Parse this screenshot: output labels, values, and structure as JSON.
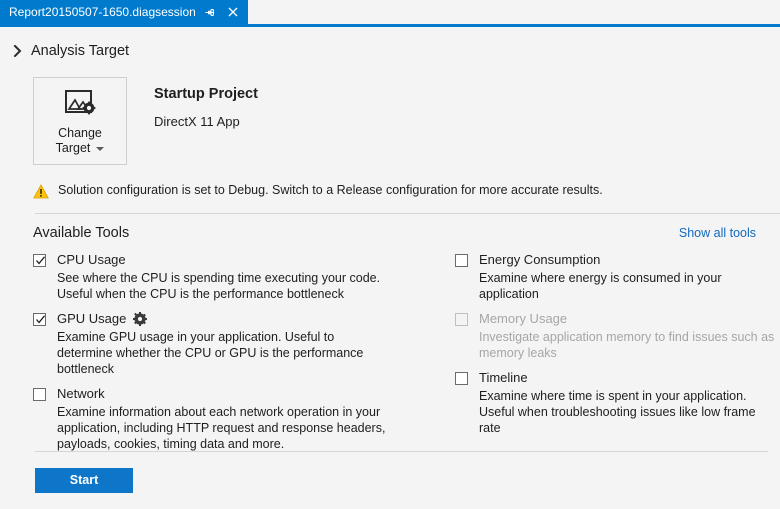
{
  "tab": {
    "title": "Report20150507-1650.diagsession",
    "pin_icon": "pin-icon",
    "close_icon": "close-icon"
  },
  "analysis_target": {
    "expander_icon": "chevron-right-icon",
    "section_title": "Analysis Target",
    "change_target": {
      "icon": "picture-settings-icon",
      "line1": "Change",
      "line2": "Target",
      "caret_icon": "caret-down-icon"
    },
    "project_label": "Startup Project",
    "project_name": "DirectX 11 App"
  },
  "warning": {
    "icon": "warning-triangle-icon",
    "text": "Solution configuration is set to Debug. Switch to a Release configuration for more accurate results."
  },
  "available_tools": {
    "title": "Available Tools",
    "show_all_link": "Show all tools",
    "left_column": [
      {
        "name": "CPU Usage",
        "checked": true,
        "enabled": true,
        "has_settings": false,
        "description": "See where the CPU is spending time executing your code. Useful when the CPU is the performance bottleneck"
      },
      {
        "name": "GPU Usage",
        "checked": true,
        "enabled": true,
        "has_settings": true,
        "settings_icon": "gear-icon",
        "description": "Examine GPU usage in your application. Useful to determine whether the CPU or GPU is the performance bottleneck"
      },
      {
        "name": "Network",
        "checked": false,
        "enabled": true,
        "has_settings": false,
        "description": "Examine information about each network operation in your application, including HTTP request and response headers, payloads, cookies, timing data and more."
      }
    ],
    "right_column": [
      {
        "name": "Energy Consumption",
        "checked": false,
        "enabled": true,
        "has_settings": false,
        "description": "Examine where energy is consumed in your application"
      },
      {
        "name": "Memory Usage",
        "checked": false,
        "enabled": false,
        "has_settings": false,
        "description": "Investigate application memory to find issues such as memory leaks"
      },
      {
        "name": "Timeline",
        "checked": false,
        "enabled": true,
        "has_settings": false,
        "description": "Examine where time is spent in your application. Useful when troubleshooting issues like low frame rate"
      }
    ]
  },
  "footer": {
    "start_label": "Start"
  },
  "colors": {
    "accent": "#007acc",
    "start_button": "#0e76c8",
    "link": "#1269bf",
    "warning": "#ffc20e",
    "page_background": "#f4f4f4",
    "disabled_text": "#a6a6a6"
  }
}
